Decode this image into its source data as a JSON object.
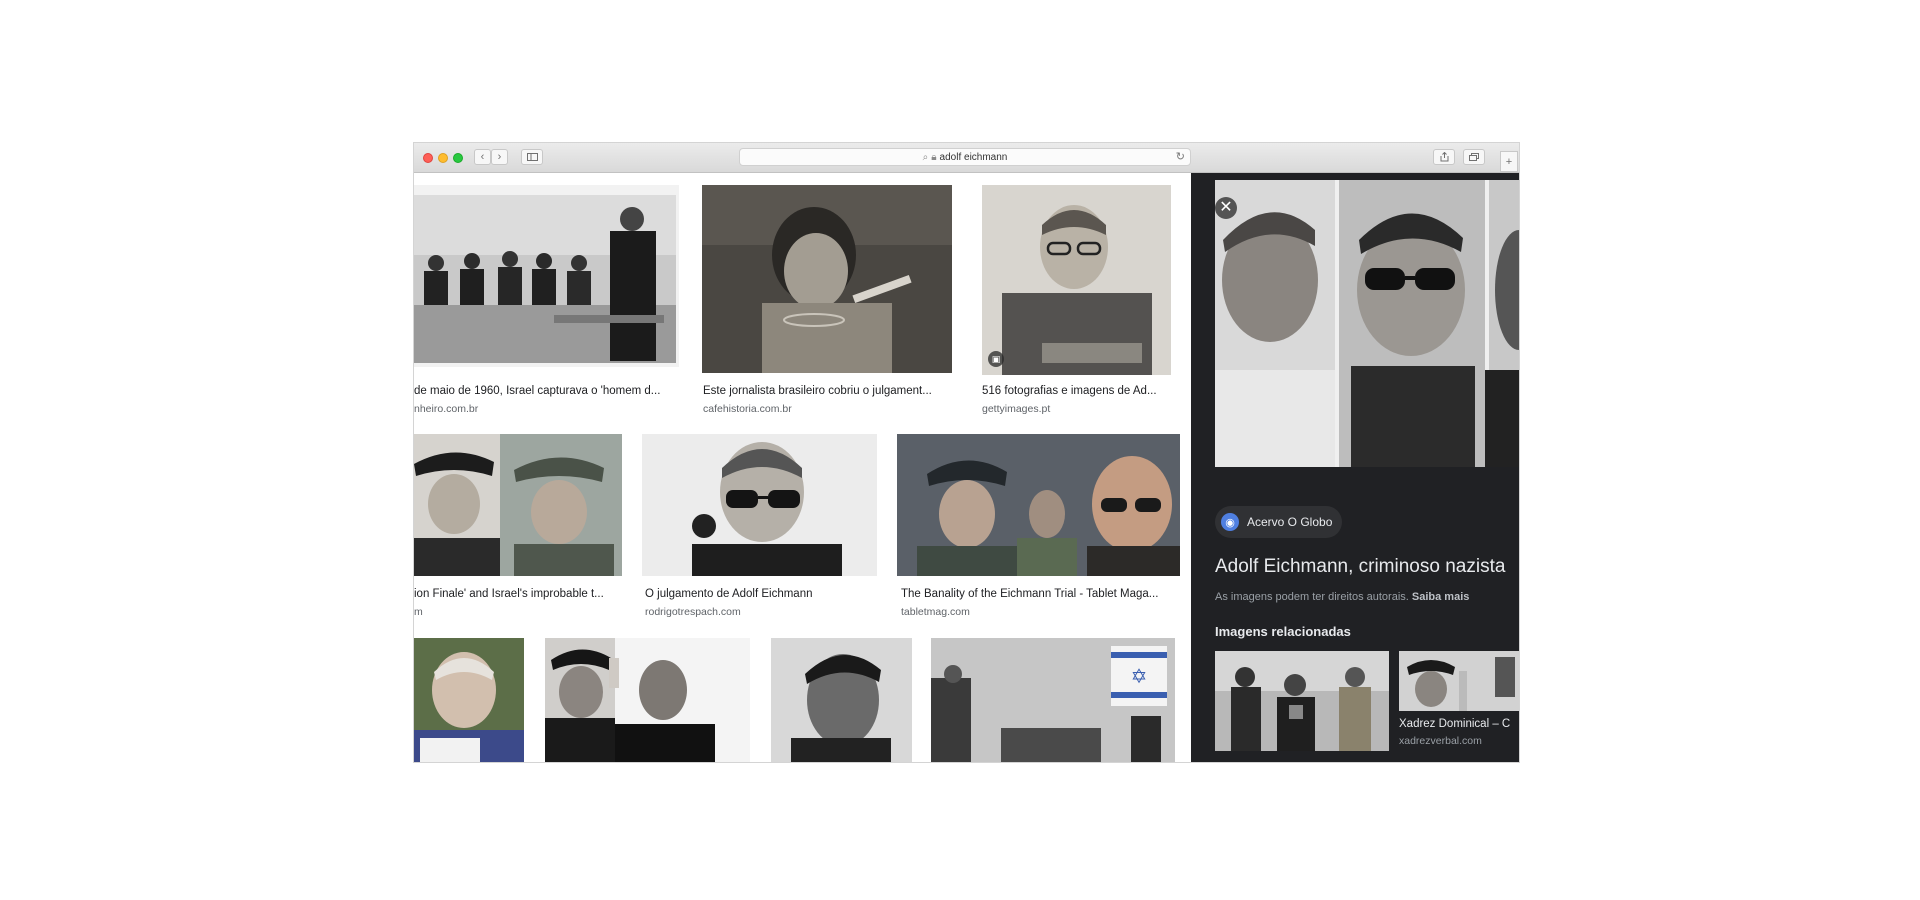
{
  "browser": {
    "address": "adolf eichmann",
    "icons": [
      "back-icon",
      "forward-icon",
      "sidebar-icon",
      "search-icon",
      "lock-icon",
      "reload-icon",
      "share-icon",
      "tabs-icon",
      "new-tab-icon"
    ]
  },
  "results": [
    {
      "caption": "de maio de 1960, Israel capturava o 'homem d...",
      "source": "nheiro.com.br"
    },
    {
      "caption": "Este jornalista brasileiro cobriu o julgament...",
      "source": "cafehistoria.com.br"
    },
    {
      "caption": "516 fotografias e imagens de Ad...",
      "source": "gettyimages.pt"
    },
    {
      "caption": "ion Finale' and Israel's improbable t...",
      "source": "m"
    },
    {
      "caption": "O julgamento de Adolf Eichmann",
      "source": "rodrigotrespach.com"
    },
    {
      "caption": "The Banality of the Eichmann Trial - Tablet Maga...",
      "source": "tabletmag.com"
    }
  ],
  "panel": {
    "close": "✕",
    "source_chip": "Acervo O Globo",
    "title": "Adolf Eichmann, criminoso nazista",
    "copyright": "As imagens podem ter direitos autorais.",
    "learn_more": "Saiba mais",
    "related_heading": "Imagens relacionadas",
    "related": [
      {
        "caption": "Xadrez Dominical – C",
        "source": "xadrezverbal.com"
      }
    ]
  },
  "colors": {
    "panel_bg": "#202124",
    "chip_bg": "#303134",
    "accent": "#4f7fe0"
  }
}
